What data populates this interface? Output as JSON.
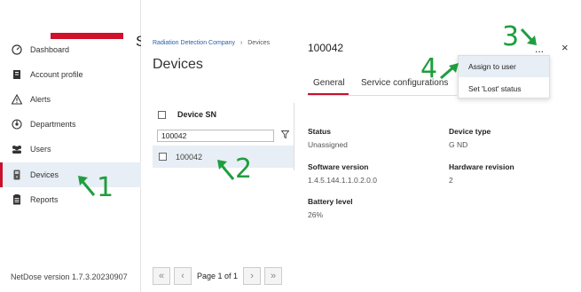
{
  "sidebar": {
    "items": [
      {
        "label": "Dashboard",
        "icon": "dashboard-icon"
      },
      {
        "label": "Account profile",
        "icon": "account-profile-icon"
      },
      {
        "label": "Alerts",
        "icon": "alert-triangle-icon"
      },
      {
        "label": "Departments",
        "icon": "departments-icon"
      },
      {
        "label": "Users",
        "icon": "users-icon"
      },
      {
        "label": "Devices",
        "icon": "device-icon"
      },
      {
        "label": "Reports",
        "icon": "reports-icon"
      }
    ],
    "active_item": "Devices",
    "version": "NetDose version 1.7.3.20230907"
  },
  "brand": {
    "title_fragment": "Se",
    "accent_color": "#d0112b"
  },
  "breadcrumb": {
    "company": "Radiation Detection Company",
    "separator": "›",
    "current": "Devices"
  },
  "list": {
    "title": "Devices",
    "column_header": "Device SN",
    "filter_value": "100042",
    "rows": [
      {
        "serial": "100042"
      }
    ],
    "pager": {
      "label": "Page 1 of 1",
      "first": "«",
      "prev": "‹",
      "next": "›",
      "last": "»"
    }
  },
  "detail": {
    "title": "100042",
    "more": "...",
    "close": "×",
    "tabs": [
      {
        "label": "General",
        "active": true
      },
      {
        "label": "Service configurations",
        "active": false
      }
    ],
    "fields": {
      "status_label": "Status",
      "status_value": "Unassigned",
      "device_type_label": "Device type",
      "device_type_value": "G ND",
      "software_label": "Software version",
      "software_value": "1.4.5.144.1.1.0.2.0.0",
      "hardware_label": "Hardware revision",
      "hardware_value": "2",
      "battery_label": "Battery level",
      "battery_value": "26%"
    },
    "menu": {
      "items": [
        "Assign to user",
        "Set 'Lost' status"
      ]
    }
  },
  "annotations": {
    "n1": "1",
    "n2": "2",
    "n3": "3",
    "n4": "4",
    "color": "#1e9e3e"
  }
}
